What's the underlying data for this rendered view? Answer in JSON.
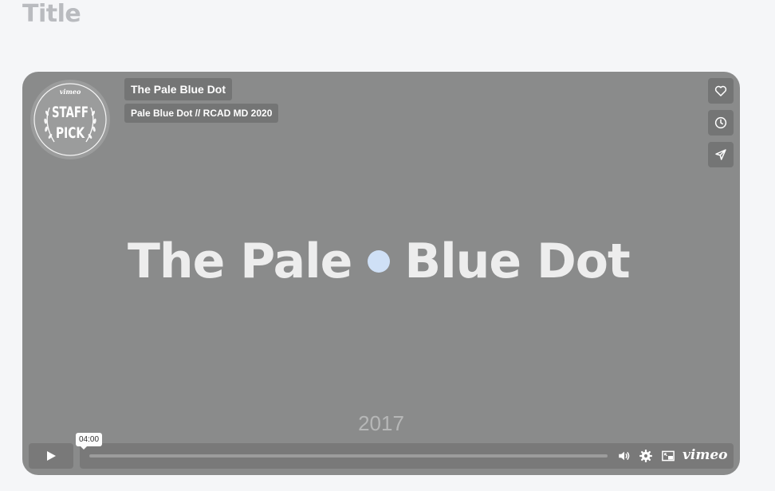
{
  "page": {
    "title": "Title"
  },
  "player": {
    "badge": {
      "brand": "vimeo",
      "line1": "STAFF",
      "line2": "PICK"
    },
    "video_title": "The Pale Blue Dot",
    "subtitle": "Pale Blue Dot // RCAD MD 2020",
    "frame": {
      "title_left": "The Pale",
      "title_right": "Blue Dot",
      "year": "2017",
      "dot_color": "#cfe0f6"
    },
    "side_buttons": [
      "heart-icon",
      "clock-icon",
      "send-icon"
    ],
    "controls": {
      "play_icon": "play-icon",
      "time_tooltip": "04:00",
      "progress": 0,
      "icons": [
        "volume-icon",
        "gear-icon",
        "pip-icon"
      ],
      "brand": "vimeo"
    }
  }
}
